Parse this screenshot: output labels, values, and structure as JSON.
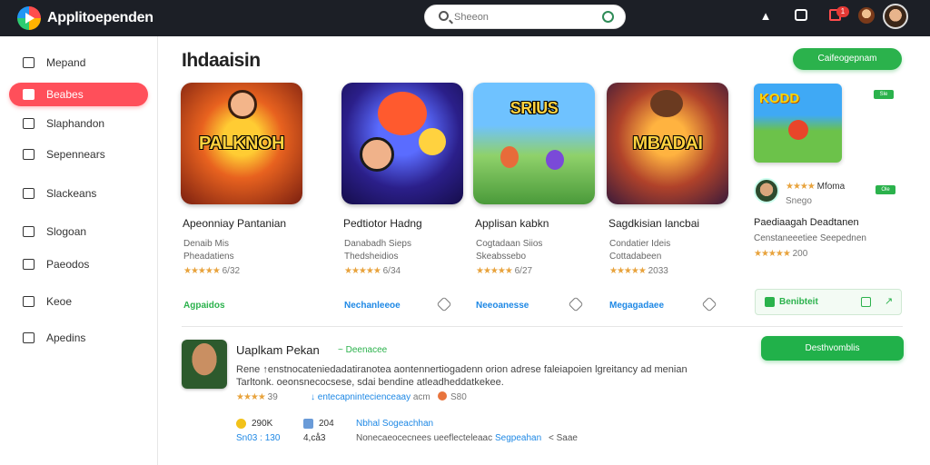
{
  "app": {
    "title": "Applitoependen"
  },
  "search": {
    "placeholder": "Sheeon",
    "value": ""
  },
  "topbar": {
    "notification_count": "1"
  },
  "sidebar": {
    "items": [
      {
        "label": "Mepand",
        "icon": "home-icon",
        "active": false
      },
      {
        "label": "Beabes",
        "icon": "bag-icon",
        "active": true
      },
      {
        "label": "Slaphandon",
        "icon": "grid-icon",
        "active": false
      },
      {
        "label": "Sepennears",
        "icon": "list-icon",
        "active": false
      },
      {
        "label": "Slackeans",
        "icon": "box-icon",
        "active": false
      },
      {
        "label": "Slogoan",
        "icon": "bookmark-icon",
        "active": false
      },
      {
        "label": "Paeodos",
        "icon": "pencil-icon",
        "active": false
      },
      {
        "label": "Keoe",
        "icon": "chat-icon",
        "active": false
      },
      {
        "label": "Apedins",
        "icon": "link-icon",
        "active": false
      }
    ]
  },
  "main": {
    "heading": "Ihdaaisin",
    "top_button": "Caifeogepnam",
    "cards": [
      {
        "thumb_text": "PALKNOH",
        "title": "Apeonniay Pantanian",
        "developer": "Denaib Mis",
        "category": "Pheadatiens",
        "rating": "6/32",
        "link": "Agpaidos",
        "link_color": "green"
      },
      {
        "thumb_text": "",
        "title": "Pedtiotor Hadng",
        "developer": "Danabadh Sieps",
        "category": "Thedsheidios",
        "rating": "6/34",
        "link": "Nechanleeoe",
        "link_color": "blue"
      },
      {
        "thumb_text": "SRIUS",
        "title": "Applisan kabkn",
        "developer": "Cogtadaan Siios",
        "category": "Skeabssebo",
        "rating": "6/27",
        "link": "Neeoanesse",
        "link_color": "blue"
      },
      {
        "thumb_text": "MBADAI",
        "title": "Sagdkisian lancbai",
        "developer": "Condatier Ideis",
        "category": "Cottadabeen",
        "rating": "2033",
        "link": "Megagadaee",
        "link_color": "blue"
      }
    ],
    "right_card": {
      "thumb_text": "KODD",
      "tag_top": "Sle",
      "tag_mid": "Ole",
      "author": "Mfoma",
      "author_sub": "Snego",
      "title": "Paediaagah Deadtanen",
      "desc": "Censtaneeetiee Seepednen",
      "rating": "200",
      "action": "Benibteit"
    },
    "listing": {
      "name": "Uaplkam Pekan",
      "sub": "Deenacee",
      "description": "Rene ↑enstnocateniedadatiranotea aontennertiogadenn orion adrese faleiapoien lgreitancy ad menian Tarltonk. oeonsnecocsese, sdai bendine atleadheddatkekee.",
      "rating": "39",
      "link": "↓ entecapnintecienceaay",
      "link_tail": "acm",
      "value": "S80",
      "stat1": "290K",
      "stat2": "204",
      "stat3": "Nbhal Sogeachhan",
      "stat4": "Sn03 : 130",
      "stat5": "4,cå3",
      "stat6": "Nonecaeocecnees ueeflecteleaac",
      "stat7": "Segpeahan",
      "stat8": "< Saae",
      "button": "Desthvomblis"
    }
  }
}
